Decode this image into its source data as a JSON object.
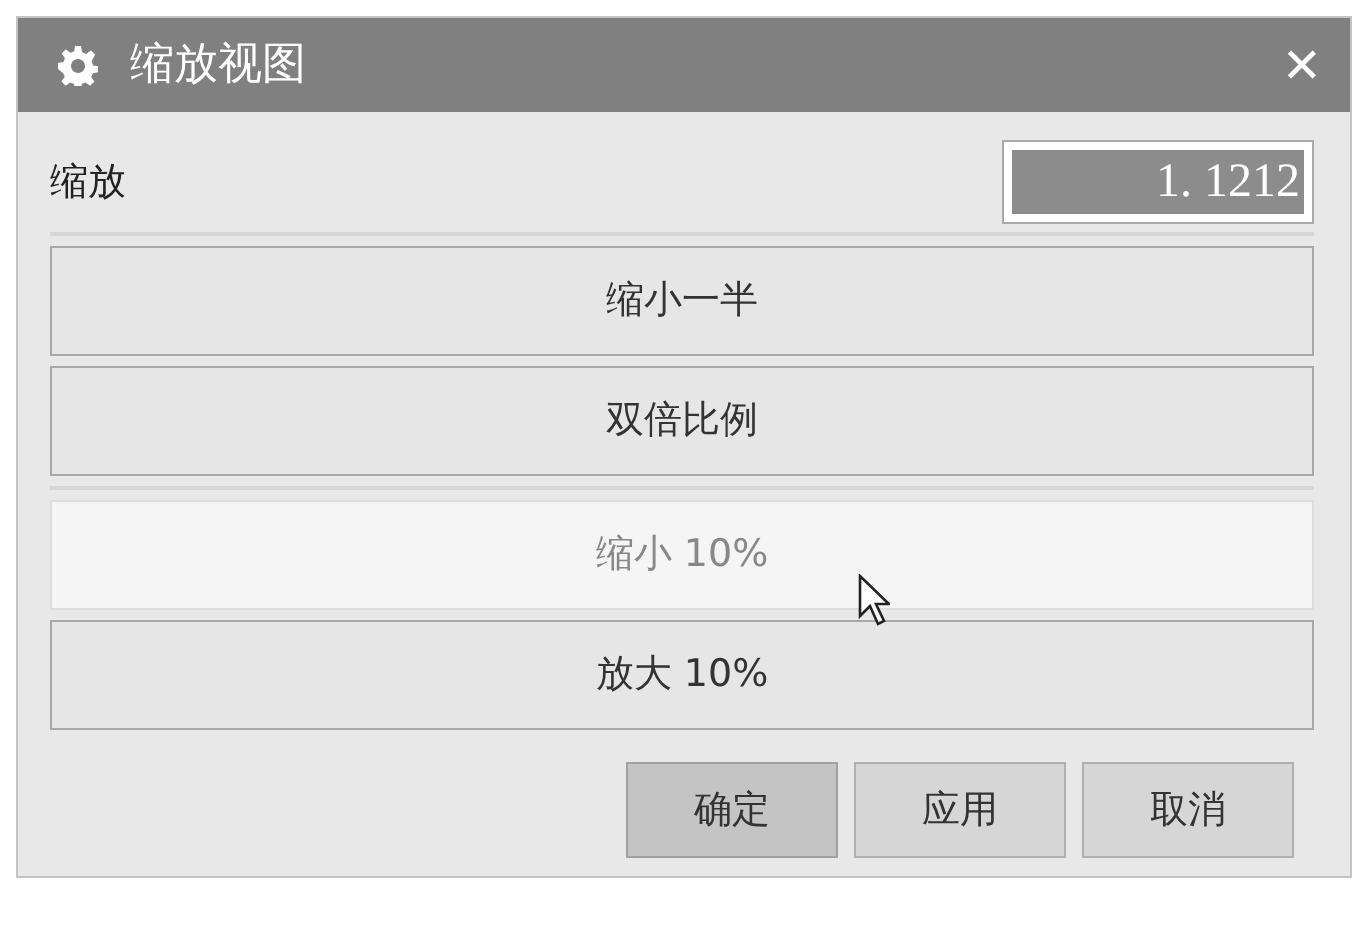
{
  "window": {
    "title": "缩放视图",
    "close": "✕"
  },
  "zoom_field": {
    "label": "缩放",
    "value": "1. 1212",
    "highlighted": true
  },
  "button_groups": [
    [
      {
        "label": "缩小一半",
        "hovered": false
      },
      {
        "label": "双倍比例",
        "hovered": false
      }
    ],
    [
      {
        "label": "缩小 10%",
        "hovered": true
      },
      {
        "label": "放大 10%",
        "hovered": false
      }
    ]
  ],
  "footer_buttons": [
    {
      "label": "确定",
      "default": true
    },
    {
      "label": "应用",
      "default": false
    },
    {
      "label": "取消",
      "default": false
    }
  ]
}
